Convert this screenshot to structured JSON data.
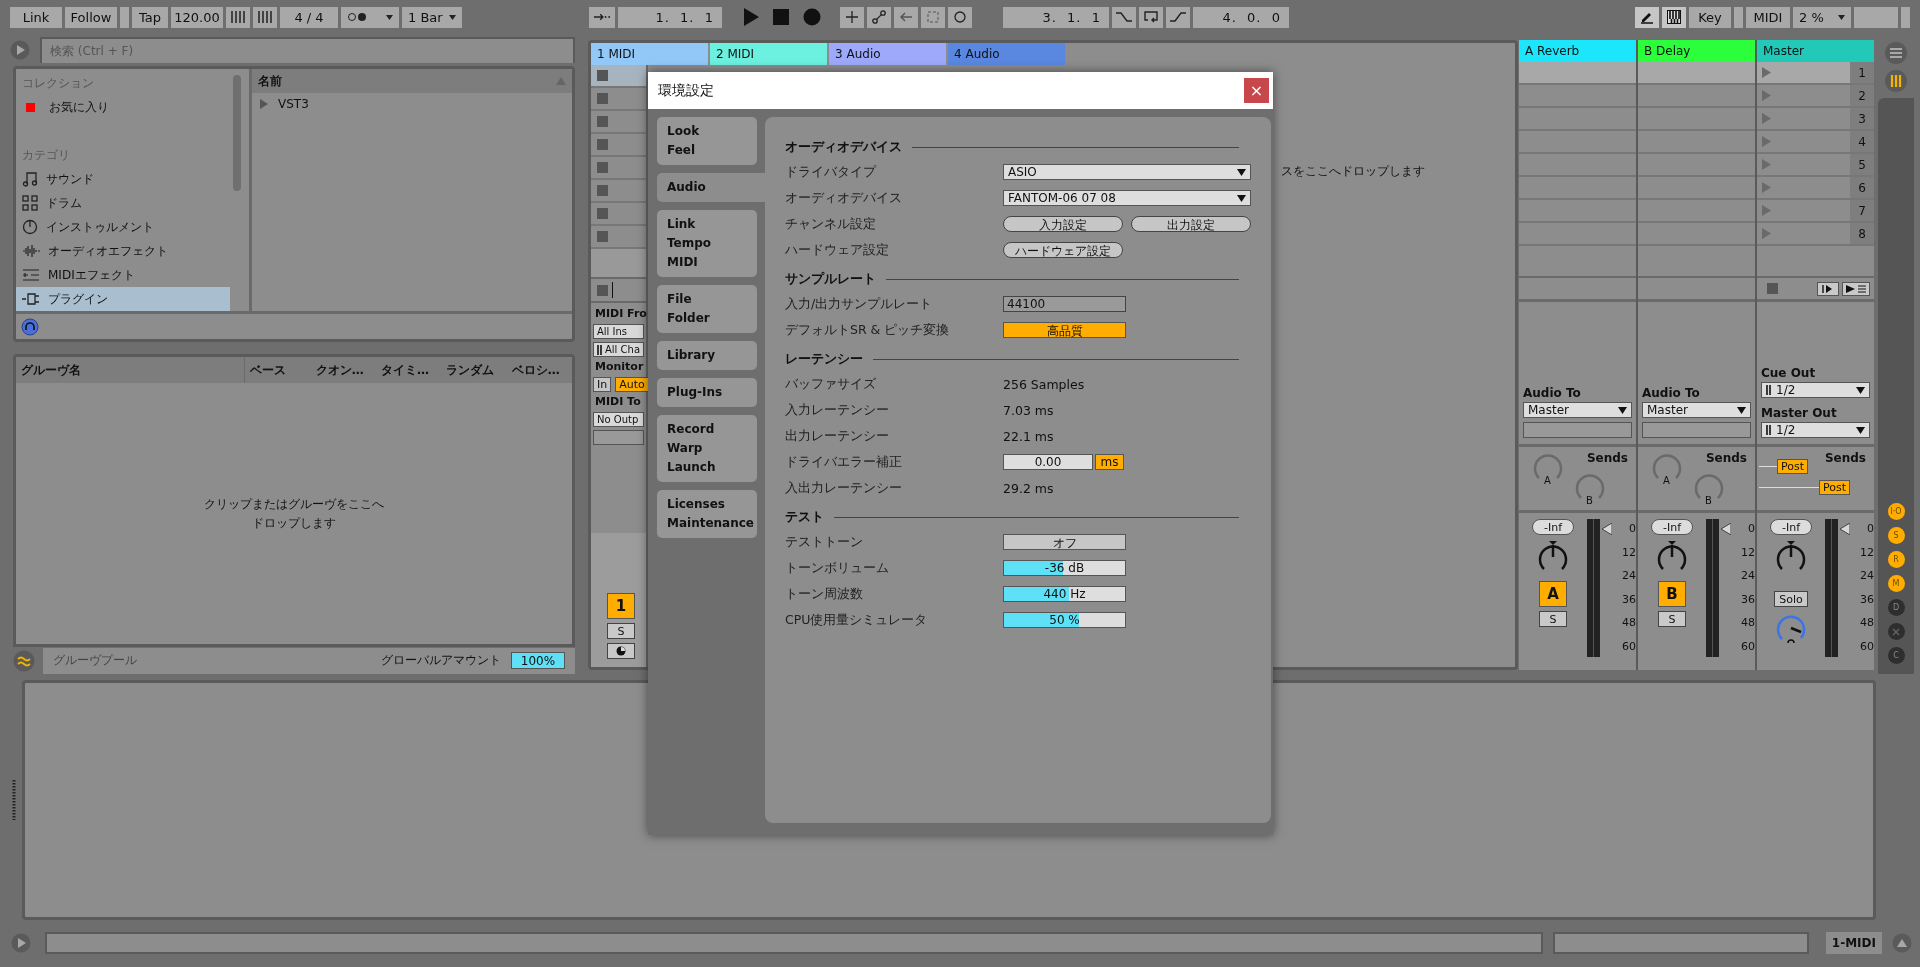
{
  "toolbar": {
    "link": "Link",
    "follow": "Follow",
    "tap": "Tap",
    "tempo": "120.00",
    "signature": "4 / 4",
    "quantization": "1 Bar",
    "arrangement_position": "1.  1.  1",
    "loop_start": "3.  1.  1",
    "loop_length": "4.  0.  0",
    "key": "Key",
    "midi": "MIDI",
    "cpu_load": "2 %"
  },
  "browser": {
    "search": {
      "placeholder": "検索 (Ctrl + F)"
    },
    "sidebar": [
      {
        "title": "コレクション",
        "items": [
          {
            "label": "お気に入り",
            "color": "#ff0000",
            "selected": false
          }
        ]
      },
      {
        "title": "カテゴリ",
        "items": [
          {
            "label": "サウンド",
            "selected": false
          },
          {
            "label": "ドラム",
            "selected": false
          },
          {
            "label": "インストゥルメント",
            "selected": false
          },
          {
            "label": "オーディオエフェクト",
            "selected": false
          },
          {
            "label": "MIDIエフェクト",
            "selected": false
          },
          {
            "label": "プラグイン",
            "selected": true
          }
        ]
      }
    ],
    "content": {
      "column": "名前",
      "rows": [
        {
          "label": "VST3",
          "expanded": false
        }
      ]
    }
  },
  "groove_pool": {
    "columns": [
      "グルーヴ名",
      "ベース",
      "クオン…",
      "タイミ…",
      "ランダム",
      "ベロシ…"
    ],
    "empty_text": [
      "クリップまたはグルーヴをここへ",
      "ドロップします"
    ],
    "title": "グルーヴプール",
    "global_amount": {
      "label": "グローバルアマウント",
      "value": "100%",
      "level": 1
    }
  },
  "session": {
    "tracks": [
      {
        "name": "1 MIDI",
        "color": "#92c8f8"
      },
      {
        "name": "2 MIDI",
        "color": "#6cf0df"
      },
      {
        "name": "3 Audio",
        "color": "#9ea9fb"
      },
      {
        "name": "4 Audio",
        "color": "#5a87e0"
      }
    ],
    "first_track": {
      "input_label": "MIDI Fro",
      "input": "All Ins",
      "channel": "All Cha",
      "monitor_label": "Monitor",
      "monitor": [
        {
          "label": "In",
          "selected": false
        },
        {
          "label": "Auto",
          "selected": true
        }
      ],
      "output_label": "MIDI To",
      "output": "No Outp",
      "activator": "1",
      "solo": "S"
    },
    "drop_text": "スをここへドロップします"
  },
  "mixer": {
    "returns": [
      {
        "name": "A Reverb",
        "color": "#1ce6fb",
        "output_label": "Audio To",
        "output": "Master",
        "sends_label": "Sends",
        "sends": [
          "A",
          "B"
        ],
        "volume": "-Inf",
        "activator": "A",
        "solo": "S",
        "meter_scale": [
          "0",
          "12",
          "24",
          "36",
          "48",
          "60"
        ]
      },
      {
        "name": "B Delay",
        "color": "#2bff3c",
        "output_label": "Audio To",
        "output": "Master",
        "sends_label": "Sends",
        "sends": [
          "A",
          "B"
        ],
        "volume": "-Inf",
        "activator": "B",
        "solo": "S",
        "meter_scale": [
          "0",
          "12",
          "24",
          "36",
          "48",
          "60"
        ]
      }
    ],
    "master": {
      "name": "Master",
      "color": "#22c9b9",
      "scenes": [
        "1",
        "2",
        "3",
        "4",
        "5",
        "6",
        "7",
        "8"
      ],
      "cue_label": "Cue Out",
      "cue": "1/2",
      "output_label": "Master Out",
      "output": "1/2",
      "sends_label": "Sends",
      "post": [
        "Post",
        "Post"
      ],
      "volume": "-Inf",
      "solo": "Solo",
      "meter_scale": [
        "0",
        "12",
        "24",
        "36",
        "48",
        "60"
      ]
    }
  },
  "view_switches": [
    {
      "kind": "text",
      "label": "I·O",
      "on": true
    },
    {
      "kind": "text",
      "label": "S",
      "on": true
    },
    {
      "kind": "text",
      "label": "R",
      "on": true
    },
    {
      "kind": "text",
      "label": "M",
      "on": true
    },
    {
      "kind": "text",
      "label": "D",
      "on": false
    },
    {
      "kind": "icon",
      "on": false
    },
    {
      "kind": "text",
      "label": "C",
      "on": false
    }
  ],
  "status_bar": {
    "track": "1-MIDI"
  },
  "preferences": {
    "title": "環境設定",
    "close": "×",
    "tabs": [
      {
        "label": "Look\nFeel",
        "selected": false
      },
      {
        "label": "Audio",
        "selected": true
      },
      {
        "label": "Link\nTempo\nMIDI",
        "selected": false
      },
      {
        "label": "File\nFolder",
        "selected": false
      },
      {
        "label": "Library",
        "selected": false
      },
      {
        "label": "Plug-Ins",
        "selected": false
      },
      {
        "label": "Record\nWarp\nLaunch",
        "selected": false
      },
      {
        "label": "Licenses\nMaintenance",
        "selected": false
      }
    ],
    "sections": [
      {
        "title": "オーディオデバイス",
        "rows": [
          {
            "kind": "dropdown",
            "label": "ドライバタイプ",
            "value": "ASIO"
          },
          {
            "kind": "dropdown",
            "label": "オーディオデバイス",
            "value": "FANTOM-06 07 08"
          },
          {
            "kind": "buttons",
            "label": "チャンネル設定",
            "buttons": [
              "入力設定",
              "出力設定"
            ]
          },
          {
            "kind": "buttons",
            "label": "ハードウェア設定",
            "buttons": [
              "ハードウェア設定"
            ]
          }
        ]
      },
      {
        "title": "サンプルレート",
        "rows": [
          {
            "kind": "field",
            "label": "入力/出力サンプルレート",
            "value": "44100"
          },
          {
            "kind": "toggle",
            "label": "デフォルトSR & ピッチ変換",
            "value": "高品質",
            "on": true
          }
        ]
      },
      {
        "title": "レーテンシー",
        "rows": [
          {
            "kind": "text",
            "label": "バッファサイズ",
            "value": "256 Samples"
          },
          {
            "kind": "text",
            "label": "入力レーテンシー",
            "value": "7.03 ms"
          },
          {
            "kind": "text",
            "label": "出力レーテンシー",
            "value": "22.1 ms"
          },
          {
            "kind": "number",
            "label": "ドライバエラー補正",
            "value": "0.00",
            "unit": "ms"
          },
          {
            "kind": "text",
            "label": "入出力レーテンシー",
            "value": "29.2 ms"
          }
        ]
      },
      {
        "title": "テスト",
        "rows": [
          {
            "kind": "toggle",
            "label": "テストトーン",
            "value": "オフ",
            "on": false
          },
          {
            "kind": "slider",
            "label": "トーンボリューム",
            "value": "-36 dB",
            "level": 0.49
          },
          {
            "kind": "slider",
            "label": "トーン周波数",
            "value": "440 Hz",
            "level": 0.54
          },
          {
            "kind": "slider",
            "label": "CPU使用量シミュレータ",
            "value": "50 %",
            "level": 0.62
          }
        ]
      }
    ]
  }
}
